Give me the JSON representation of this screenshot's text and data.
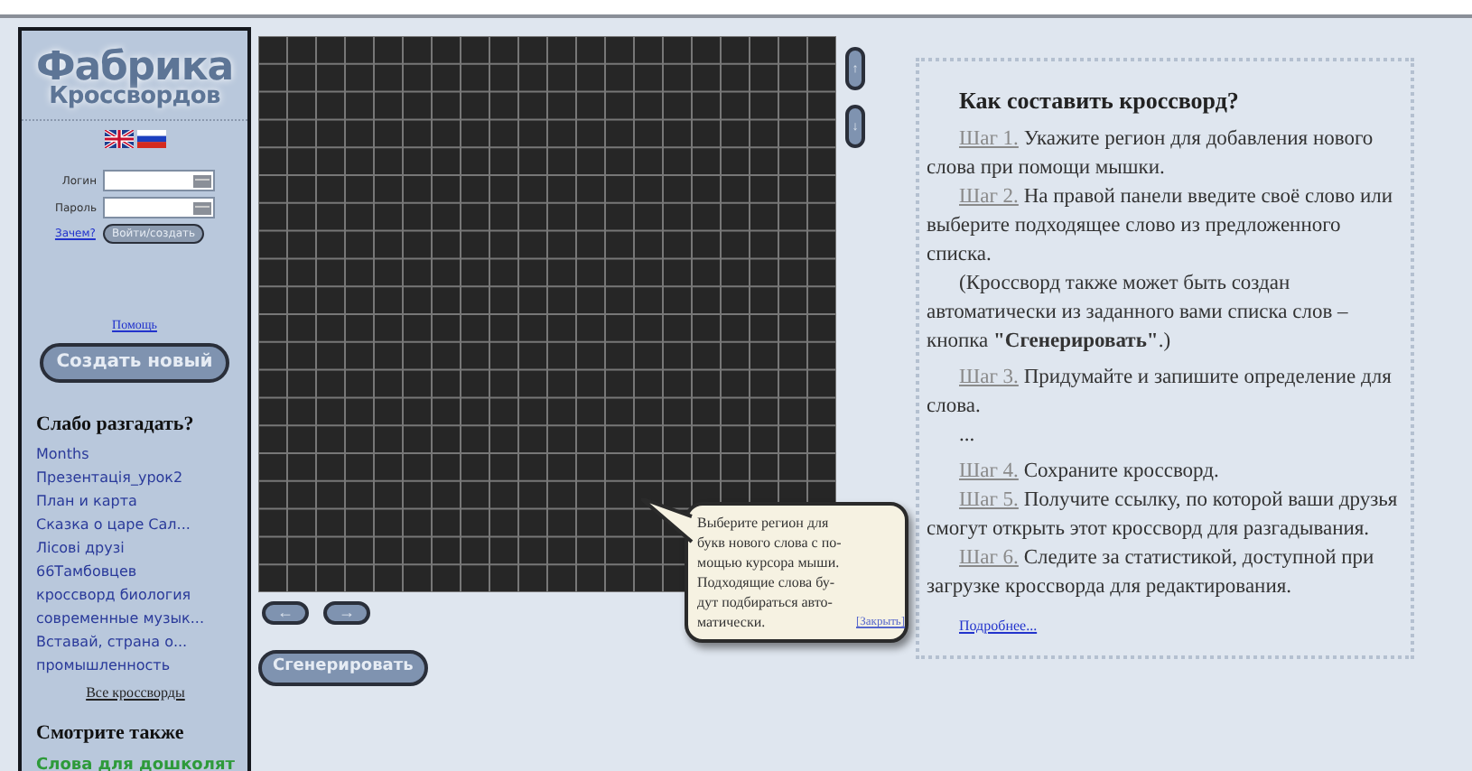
{
  "logo": {
    "line1": "Фабрика",
    "line2": "Кроссвордов"
  },
  "languages": [
    {
      "kind": "en"
    },
    {
      "kind": "ru"
    }
  ],
  "login": {
    "login_label": "Логин",
    "password_label": "Пароль",
    "why_link": "Зачем?",
    "submit": "Войти/создать"
  },
  "help_link": "Помощь",
  "create_button": "Создать новый",
  "challenge": {
    "title": "Слабо разгадать?",
    "items": [
      "Months",
      "Презентація_урок2",
      "План и карта",
      "Сказка о царе Сал...",
      "Лісові друзі",
      "66Тамбовцев",
      "кроссворд биология",
      "современные музык...",
      "Вставай, страна о...",
      "промышленность"
    ],
    "all_link": "Все кроссворды"
  },
  "see_also": {
    "title": "Смотрите также",
    "links": [
      "Слова для дошколят"
    ]
  },
  "grid_controls": {
    "up": "↑",
    "down": "↓",
    "left": "←",
    "right": "→",
    "generate": "Сгенерировать"
  },
  "help": {
    "title": "Как составить кроссворд?",
    "paragraphs": [
      {
        "kind": "step",
        "step": "Шаг 1.",
        "text": "Укажите регион для добавления нового слова при помощи мышки."
      },
      {
        "kind": "step",
        "step": "Шаг 2.",
        "text": "На правой панели введите своё слово или выберите подходящее слово из предложенного списка."
      },
      {
        "kind": "note",
        "text": "(Кроссворд также может быть создан автоматически из заданного вами списка слов – кнопка **\"Сгенерировать\"**.)"
      },
      {
        "kind": "step",
        "step": "Шаг 3.",
        "text": "Придумайте и запишите определение для слова."
      },
      {
        "kind": "note",
        "text": "..."
      },
      {
        "kind": "step",
        "step": "Шаг 4.",
        "text": "Сохраните кроссворд."
      },
      {
        "kind": "step",
        "step": "Шаг 5.",
        "text": "Получите ссылку, по которой ваши друзья смогут открыть этот кроссворд для разгадывания."
      },
      {
        "kind": "step",
        "step": "Шаг 6.",
        "text": "Следите за статистикой, доступной при загрузке кроссворда для редактирования."
      }
    ],
    "more_link": "Подробнее..."
  },
  "tooltip": {
    "text": "Выберите регион для\nбукв нового слова с по-\nмощью курсора мыши.\nПодходящие слова бу-\nдут подбираться авто-\nматически.",
    "close": "[Закрыть]"
  }
}
